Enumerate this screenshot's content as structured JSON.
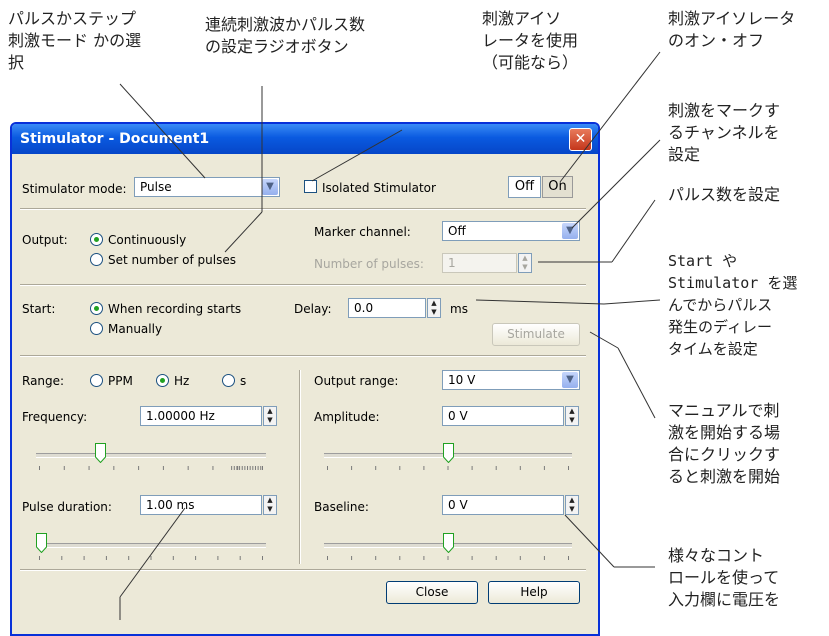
{
  "annotations": {
    "mode": "パルスかステップ\n刺激モード かの選\n択",
    "radio_set": "連続刺激波かパルス数\nの設定ラジオボタン",
    "isolator": "刺激アイソ\nレータを使用\n（可能なら）",
    "onoff": "刺激アイソレータ\nのオン・オフ",
    "marker": "刺激をマークす\nるチャンネルを\n設定",
    "pulses": "パルス数を設定",
    "delay": "Start や\nStimulator を選\nんでからパルス\n発生のディレー\nタイムを設定",
    "manual": "マニュアルで刺\n激を開始する場\n合にクリックす\nると刺激を開始",
    "controls": "様々なコント\nロールを使って\n入力欄に電圧を"
  },
  "dialog": {
    "title": "Stimulator - Document1",
    "stim_mode_label": "Stimulator mode:",
    "stim_mode_value": "Pulse",
    "isolated_label": "Isolated Stimulator",
    "off_label": "Off",
    "on_label": "On",
    "output_label": "Output:",
    "continuously": "Continuously",
    "set_number": "Set number of pulses",
    "marker_label": "Marker channel:",
    "marker_value": "Off",
    "num_pulses_label": "Number of pulses:",
    "num_pulses_value": "1",
    "start_label": "Start:",
    "when_recording": "When recording starts",
    "manually": "Manually",
    "delay_label": "Delay:",
    "delay_value": "0.0",
    "delay_unit": "ms",
    "stimulate": "Stimulate",
    "range_label": "Range:",
    "range_ppm": "PPM",
    "range_hz": "Hz",
    "range_s": "s",
    "output_range_label": "Output range:",
    "output_range_value": "10 V",
    "frequency_label": "Frequency:",
    "frequency_value": "1.00000 Hz",
    "amplitude_label": "Amplitude:",
    "amplitude_value": "0 V",
    "pulse_duration_label": "Pulse duration:",
    "pulse_duration_value": "1.00 ms",
    "baseline_label": "Baseline:",
    "baseline_value": "0 V",
    "close": "Close",
    "help": "Help"
  },
  "sliders": {
    "frequency": 0.27,
    "pulse_duration": 0.0,
    "amplitude": 0.5,
    "baseline": 0.5
  },
  "colors": {
    "title_bar": "#0a5ae0",
    "dialog_bg": "#ece9d8",
    "close_x": "#c4361b",
    "slider_thumb": "#21a121"
  }
}
